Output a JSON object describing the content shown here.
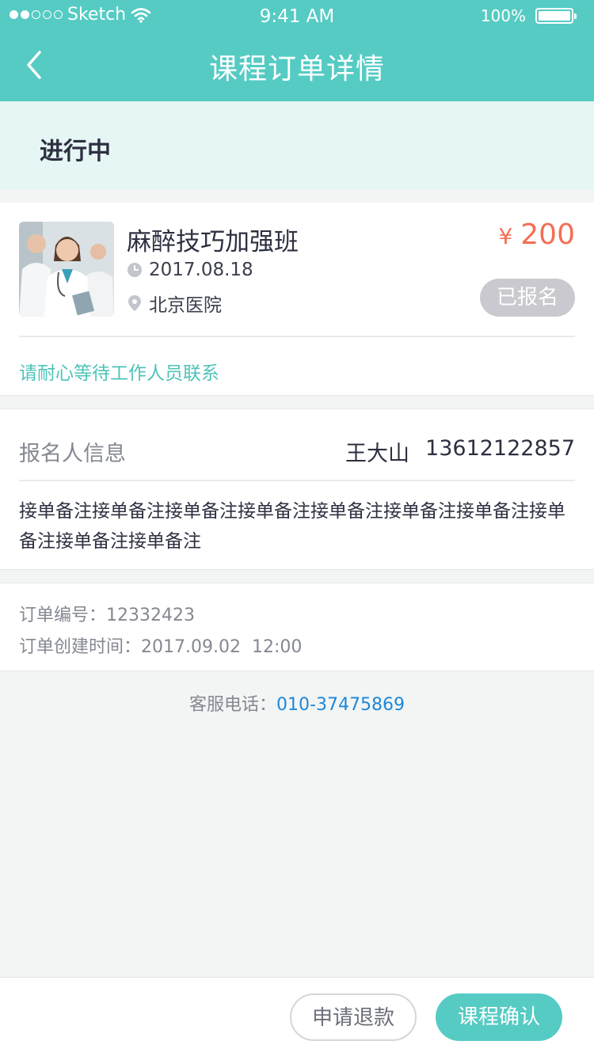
{
  "status_bar": {
    "carrier": "Sketch",
    "time": "9:41 AM",
    "battery": "100%"
  },
  "header": {
    "title": "课程订单详情"
  },
  "order_status": {
    "label": "进行中"
  },
  "course": {
    "title": "麻醉技巧加强班",
    "currency_symbol": "¥",
    "price": "200",
    "date": "2017.08.18",
    "location": "北京医院",
    "badge": "已报名",
    "notice": "请耐心等待工作人员联系"
  },
  "registrant": {
    "label": "报名人信息",
    "name": "王大山",
    "phone": "13612122857",
    "remark": "接单备注接单备注接单备注接单备注接单备注接单备注接单备注接单备注接单备注接单备注"
  },
  "order_info": {
    "number_label": "订单编号：",
    "number": "12332423",
    "created_label": "订单创建时间：",
    "created": "2017.09.02  12:00"
  },
  "service": {
    "label": "客服电话：",
    "phone": "010-37475869"
  },
  "actions": {
    "refund_label": "申请退款",
    "confirm_label": "课程确认"
  },
  "colors": {
    "brand": "#55cbc3",
    "price": "#f36e53",
    "link": "#1e88d8",
    "notice": "#4fc3b9"
  },
  "icons": {
    "back": "chevron-left-icon",
    "wifi": "wifi-icon",
    "battery": "battery-icon",
    "clock": "clock-icon",
    "location": "location-pin-icon"
  }
}
